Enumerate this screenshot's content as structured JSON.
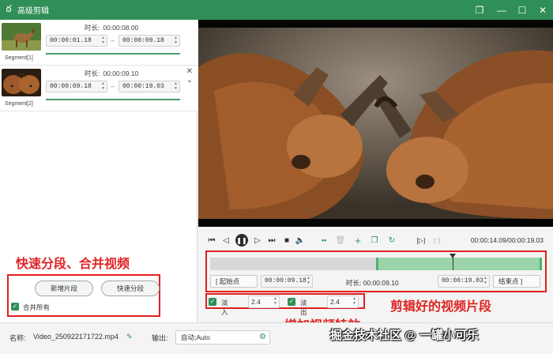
{
  "app": {
    "title": "高级剪辑",
    "logo_icon": "rabbit-logo"
  },
  "window_controls": {
    "restore": "❐",
    "minimize": "—",
    "maximize": "☐",
    "close": "✕"
  },
  "segments": [
    {
      "name": "Segment[1]",
      "duration_label": "时长:",
      "duration": "00:00:08.00",
      "start": "00:00:01.18",
      "end": "00:00:09.18"
    },
    {
      "name": "Segment[2]",
      "duration_label": "时长:",
      "duration": "00:00:09.10",
      "start": "00:00:09.18",
      "end": "00:00:19.03"
    }
  ],
  "left_actions": {
    "add_segment": "新增片段",
    "quick_split": "快速分段",
    "merge_all": "合并所有",
    "merge_all_checked": true
  },
  "playback": {
    "current_time": "00:00:14.09/00:00:19.03"
  },
  "range": {
    "start_button": "[   起始点",
    "start_time": "00:00:09.18",
    "duration_label": "时长:",
    "duration": "00:00:09.10",
    "end_time": "00:00:19.03",
    "end_button": "结束点   ]",
    "selection_start": 0.5,
    "selection_end": 1.0,
    "playhead": 0.73
  },
  "effects": {
    "fade_in_label": "淡入",
    "fade_in_value": "2.4",
    "fade_in_checked": true,
    "fade_out_label": "淡出",
    "fade_out_value": "2.4",
    "fade_out_checked": true
  },
  "output": {
    "name_label": "名称:",
    "filename": "Video_250922171722.mp4",
    "output_label": "输出:",
    "output_value": "自动;Auto"
  },
  "annotations": {
    "left": "快速分段、合并视频",
    "right": "剪辑好的视频片段",
    "bottom": "增加视频特效"
  },
  "watermark": "掘金技术社区 @ 一罐小可乐",
  "colors": {
    "brand": "#2f8f57",
    "annotation": "#e02020",
    "selection": "#9bd3aa"
  }
}
